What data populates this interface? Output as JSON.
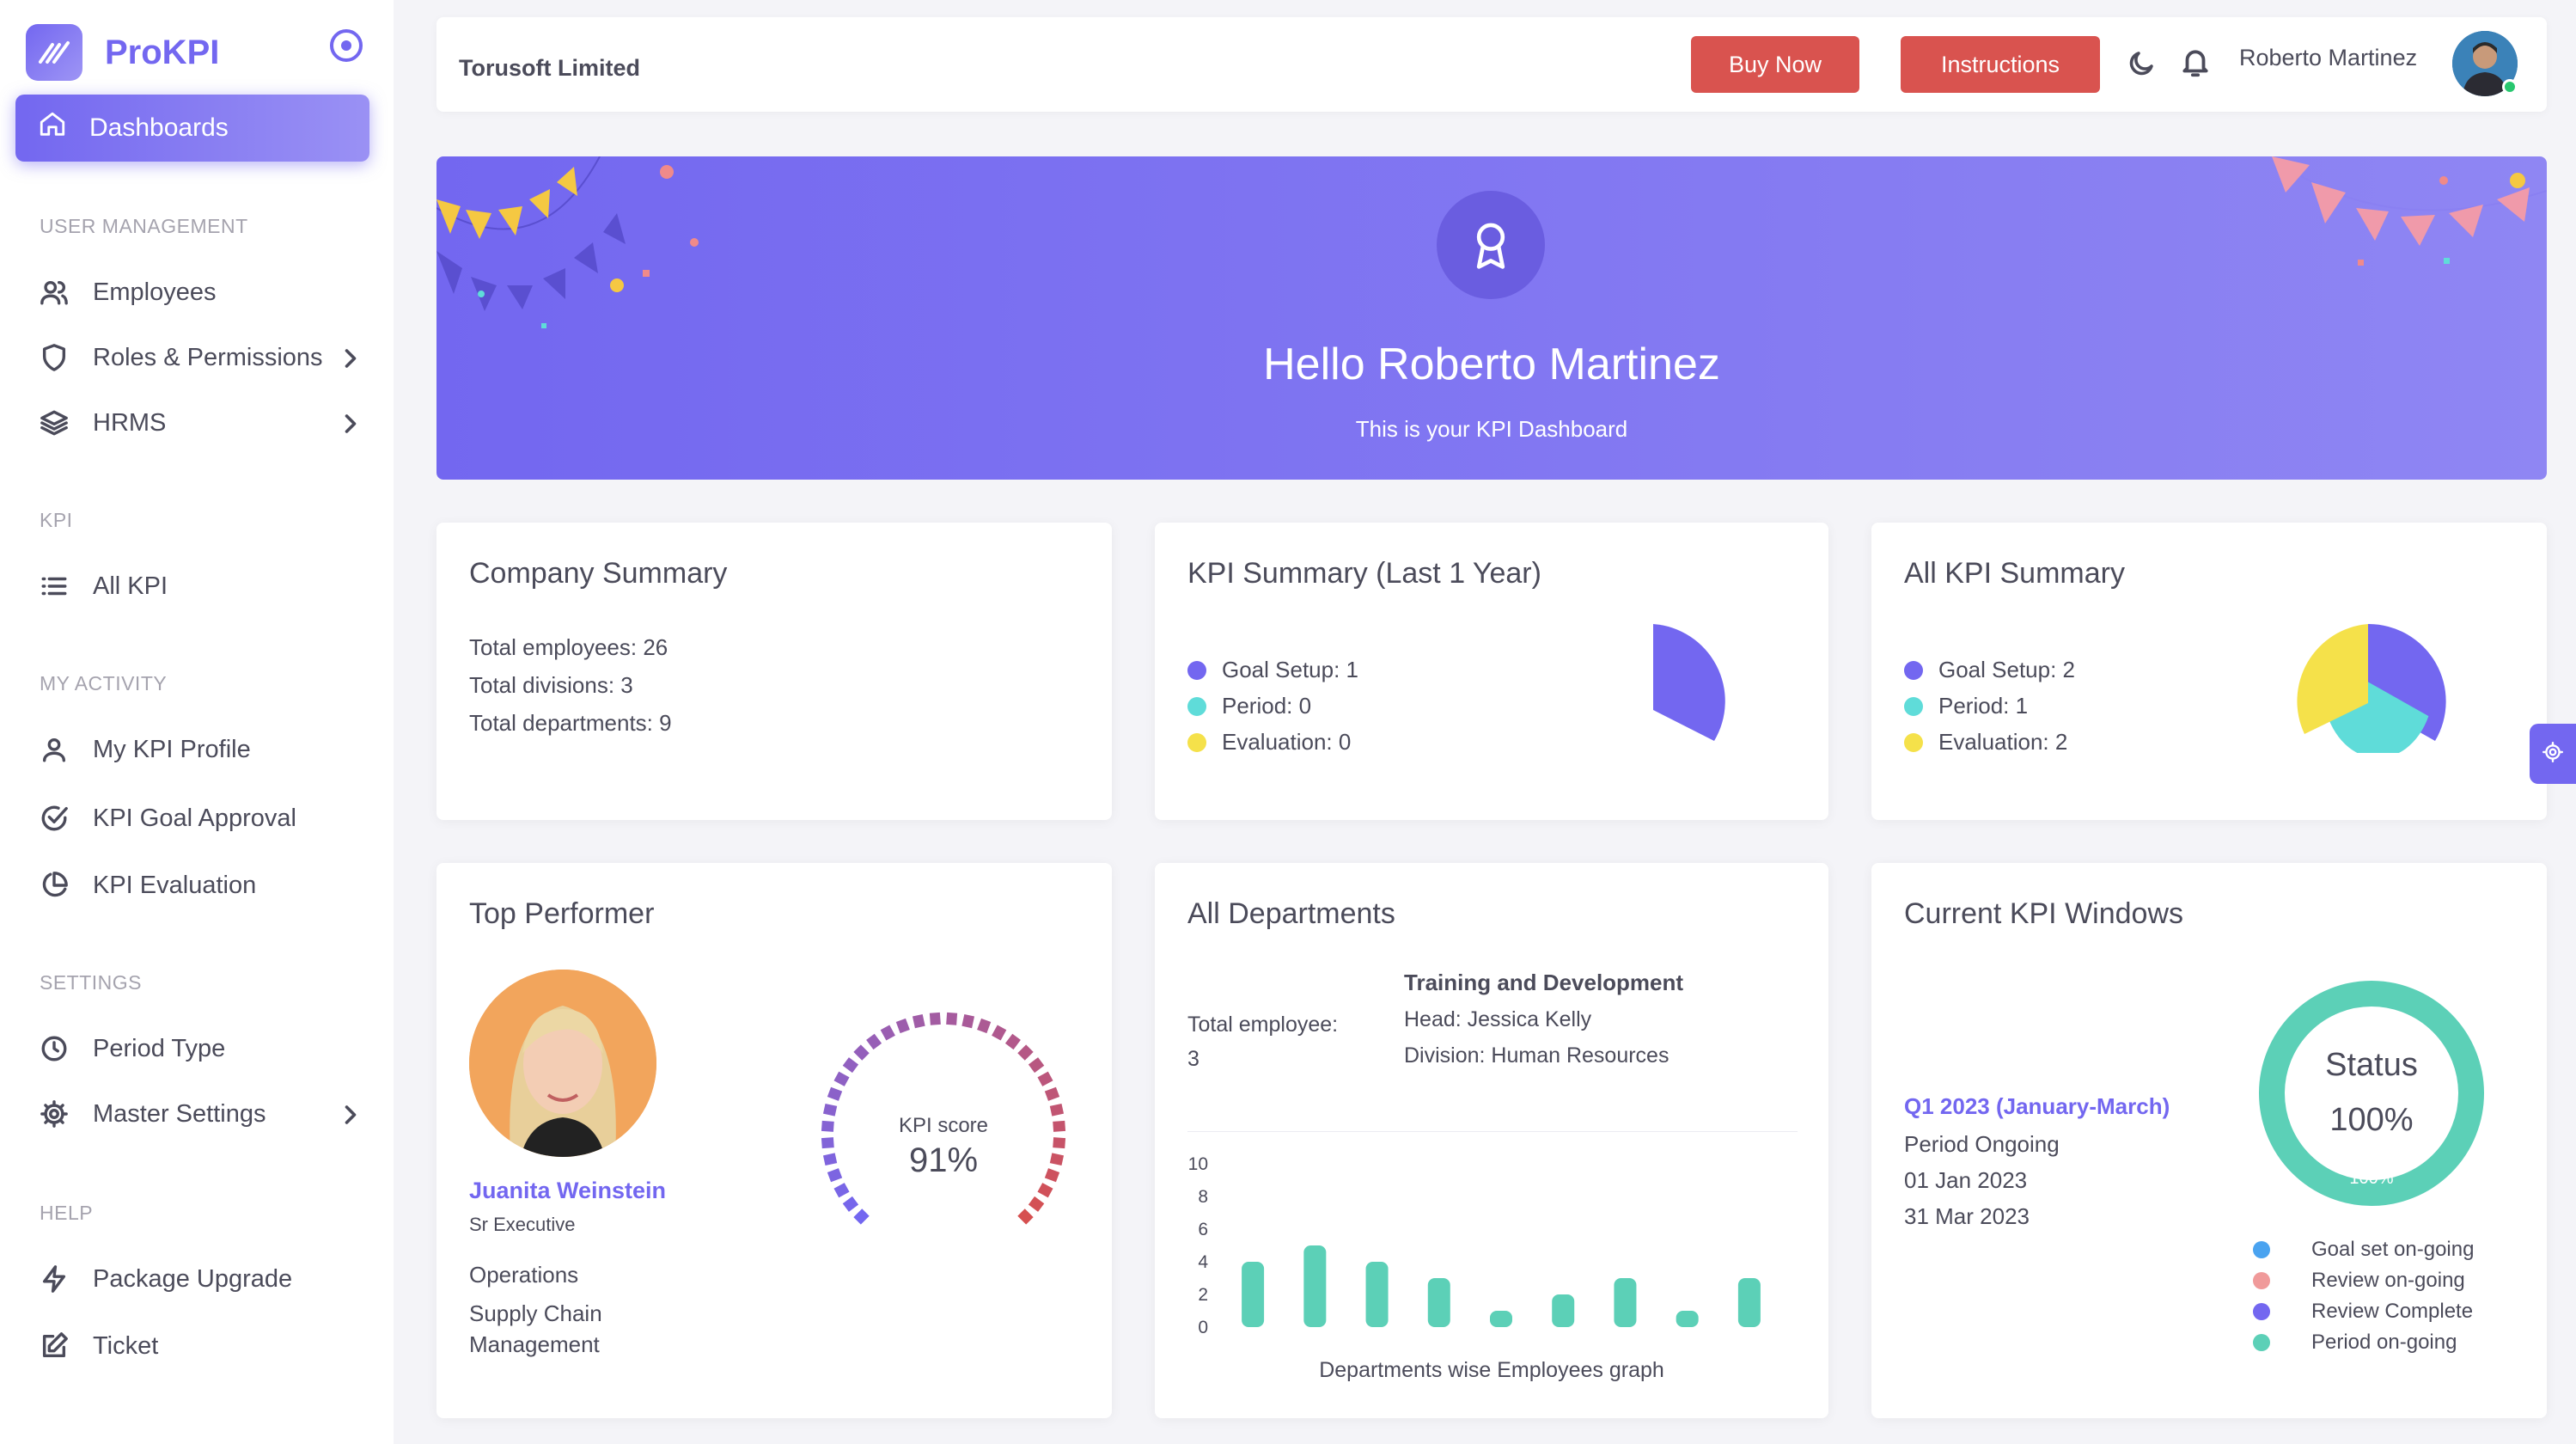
{
  "brand": {
    "name": "ProKPI"
  },
  "sidebar": {
    "active": "Dashboards",
    "sections": {
      "user_management": "USER MANAGEMENT",
      "kpi": "KPI",
      "my_activity": "MY ACTIVITY",
      "settings": "SETTINGS",
      "help": "HELP"
    },
    "items": {
      "employees": "Employees",
      "roles": "Roles & Permissions",
      "hrms": "HRMS",
      "all_kpi": "All KPI",
      "my_kpi_profile": "My KPI Profile",
      "kpi_goal_approval": "KPI Goal Approval",
      "kpi_evaluation": "KPI Evaluation",
      "period_type": "Period Type",
      "master_settings": "Master Settings",
      "package_upgrade": "Package Upgrade",
      "ticket": "Ticket"
    }
  },
  "topbar": {
    "company": "Torusoft Limited",
    "buy_now": "Buy Now",
    "instructions": "Instructions",
    "user_name": "Roberto Martinez"
  },
  "banner": {
    "title": "Hello Roberto Martinez",
    "subtitle": "This is your KPI Dashboard"
  },
  "company_summary": {
    "title": "Company Summary",
    "employees": "Total employees: 26",
    "divisions": "Total divisions: 3",
    "departments": "Total departments: 9"
  },
  "kpi_summary_year": {
    "title": "KPI Summary (Last 1 Year)",
    "legend": [
      "Goal Setup: 1",
      "Period: 0",
      "Evaluation: 0"
    ],
    "values": [
      1,
      0,
      0
    ]
  },
  "all_kpi_summary": {
    "title": "All KPI Summary",
    "legend": [
      "Goal Setup: 2",
      "Period: 1",
      "Evaluation: 2"
    ],
    "values": [
      2,
      1,
      2
    ]
  },
  "colors": {
    "goal": "#7367f0",
    "period": "#5fdcd9",
    "evaluation": "#f5e14a",
    "accent": "#7367f0",
    "danger": "#d9534f",
    "teal": "#5cd0b7"
  },
  "top_performer": {
    "title": "Top Performer",
    "name": "Juanita Weinstein",
    "role": "Sr Executive",
    "department": "Operations",
    "team": "Supply Chain Management",
    "score_label": "KPI score",
    "score": "91%",
    "score_value": 91
  },
  "departments": {
    "title": "All Departments",
    "total_label": "Total employee:",
    "total_value": "3",
    "dept_name": "Training and Development",
    "head": "Head: Jessica Kelly",
    "division": "Division: Human Resources",
    "caption": "Departments wise Employees graph"
  },
  "kpi_windows": {
    "title": "Current KPI Windows",
    "period": "Q1 2023 (January-March)",
    "status": "Period Ongoing",
    "start": "01 Jan 2023",
    "end": "31 Mar 2023",
    "donut_title": "Status",
    "donut_value": "100%",
    "donut_inner": "100%",
    "legend": [
      "Goal set on-going",
      "Review on-going",
      "Review Complete",
      "Period on-going"
    ],
    "legend_colors": [
      "#4aa3f0",
      "#f09a9a",
      "#7367f0",
      "#5cd0b7"
    ]
  },
  "chart_data": {
    "type": "bar",
    "categories": [
      "",
      "",
      "",
      "",
      "",
      "",
      "",
      "",
      ""
    ],
    "values": [
      4,
      5,
      4,
      3,
      1,
      2,
      3,
      1,
      3
    ],
    "title": "",
    "xlabel": "Departments wise Employees graph",
    "ylabel": "",
    "ylim": [
      0,
      10
    ],
    "yticks": [
      "10",
      "8",
      "6",
      "4",
      "2",
      "0"
    ],
    "color": "#5cd0b7"
  }
}
